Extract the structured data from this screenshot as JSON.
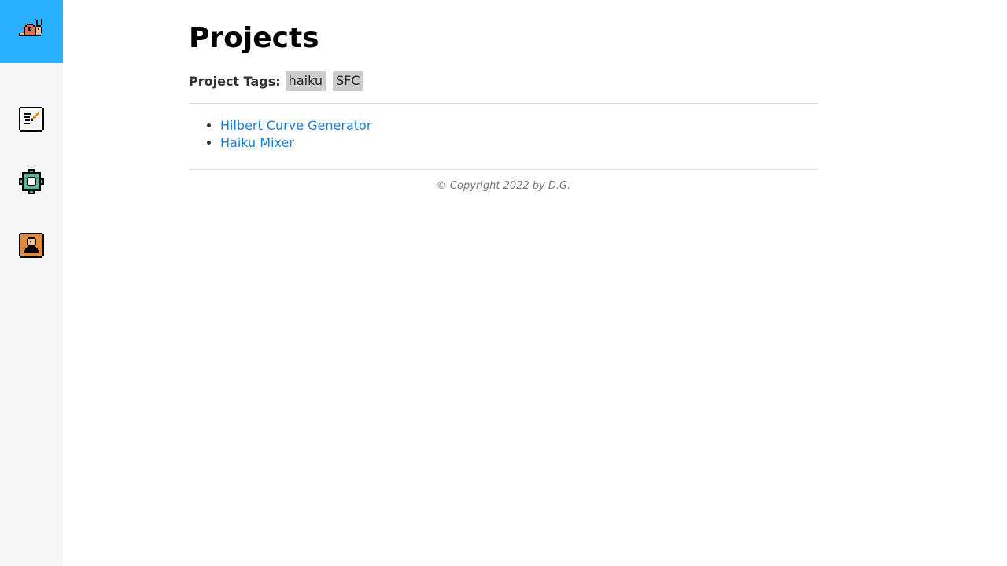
{
  "sidebar": {
    "logo_icon": "snail-icon",
    "items": [
      {
        "icon": "notepad-pencil-icon",
        "label": "Blog"
      },
      {
        "icon": "gear-icon",
        "label": "Projects"
      },
      {
        "icon": "person-portrait-icon",
        "label": "About"
      }
    ],
    "accent_color": "#29b0ff"
  },
  "main": {
    "title": "Projects",
    "tags_label": "Project Tags:",
    "tags": [
      "haiku",
      "SFC"
    ],
    "projects": [
      "Hilbert Curve Generator",
      "Haiku Mixer"
    ],
    "link_color": "#1a7fd0"
  },
  "footer": {
    "copyright": "© Copyright 2022 by D.G."
  }
}
